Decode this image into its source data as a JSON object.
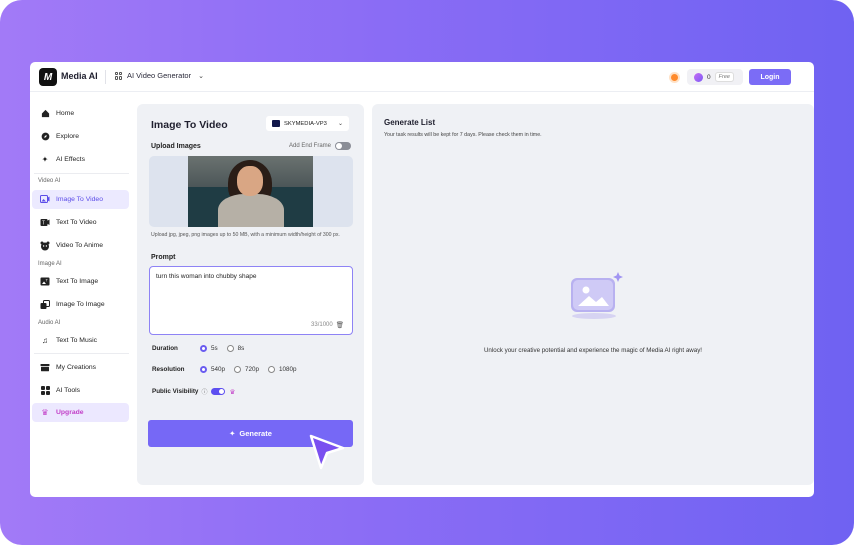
{
  "header": {
    "logo_mark": "M",
    "brand": "Media AI",
    "product_dropdown": "AI Video Generator",
    "credits": "0",
    "free_badge": "Free",
    "login": "Login"
  },
  "sidebar": {
    "items_top": [
      {
        "label": "Home",
        "icon": "home-icon"
      },
      {
        "label": "Explore",
        "icon": "compass-icon"
      },
      {
        "label": "AI Effects",
        "icon": "sparkles-icon"
      }
    ],
    "section_video": "Video AI",
    "items_video": [
      {
        "label": "Image To Video",
        "icon": "image-video-icon",
        "active": true
      },
      {
        "label": "Text To Video",
        "icon": "text-video-icon"
      },
      {
        "label": "Video To Anime",
        "icon": "anime-icon"
      }
    ],
    "section_image": "Image AI",
    "items_image": [
      {
        "label": "Text To Image",
        "icon": "text-image-icon"
      },
      {
        "label": "Image To Image",
        "icon": "image-image-icon"
      }
    ],
    "section_audio": "Audio AI",
    "items_audio": [
      {
        "label": "Text To Music",
        "icon": "music-icon"
      }
    ],
    "items_bottom": [
      {
        "label": "My Creations",
        "icon": "folder-icon"
      },
      {
        "label": "AI Tools",
        "icon": "grid-icon"
      }
    ],
    "upgrade": "Upgrade"
  },
  "form": {
    "title": "Image To Video",
    "model": "SKYMEDIA-VP3",
    "upload_label": "Upload Images",
    "end_frame_label": "Add End Frame",
    "upload_hint": "Upload jpg, jpeg, png images up to 50 MB, with a minimum width/height of 300 px.",
    "prompt_label": "Prompt",
    "prompt_value": "turn this woman into chubby shape",
    "prompt_counter": "33/1000",
    "duration": {
      "label": "Duration",
      "options": [
        "5s",
        "8s"
      ],
      "selected": "5s"
    },
    "resolution": {
      "label": "Resolution",
      "options": [
        "540p",
        "720p",
        "1080p"
      ],
      "selected": "540p"
    },
    "visibility": {
      "label": "Public Visibility",
      "on": true
    },
    "generate": "Generate"
  },
  "list": {
    "title": "Generate List",
    "subtitle": "Your task results will be kept for 7 days. Please check them in time.",
    "empty_message": "Unlock your creative potential and experience the magic of Media AI right away!"
  },
  "colors": {
    "accent": "#7668f6",
    "active_bg": "#eceaff",
    "upgrade": "#c23fc8",
    "background_gradient_start": "#a27af7",
    "background_gradient_end": "#6f62f2"
  }
}
